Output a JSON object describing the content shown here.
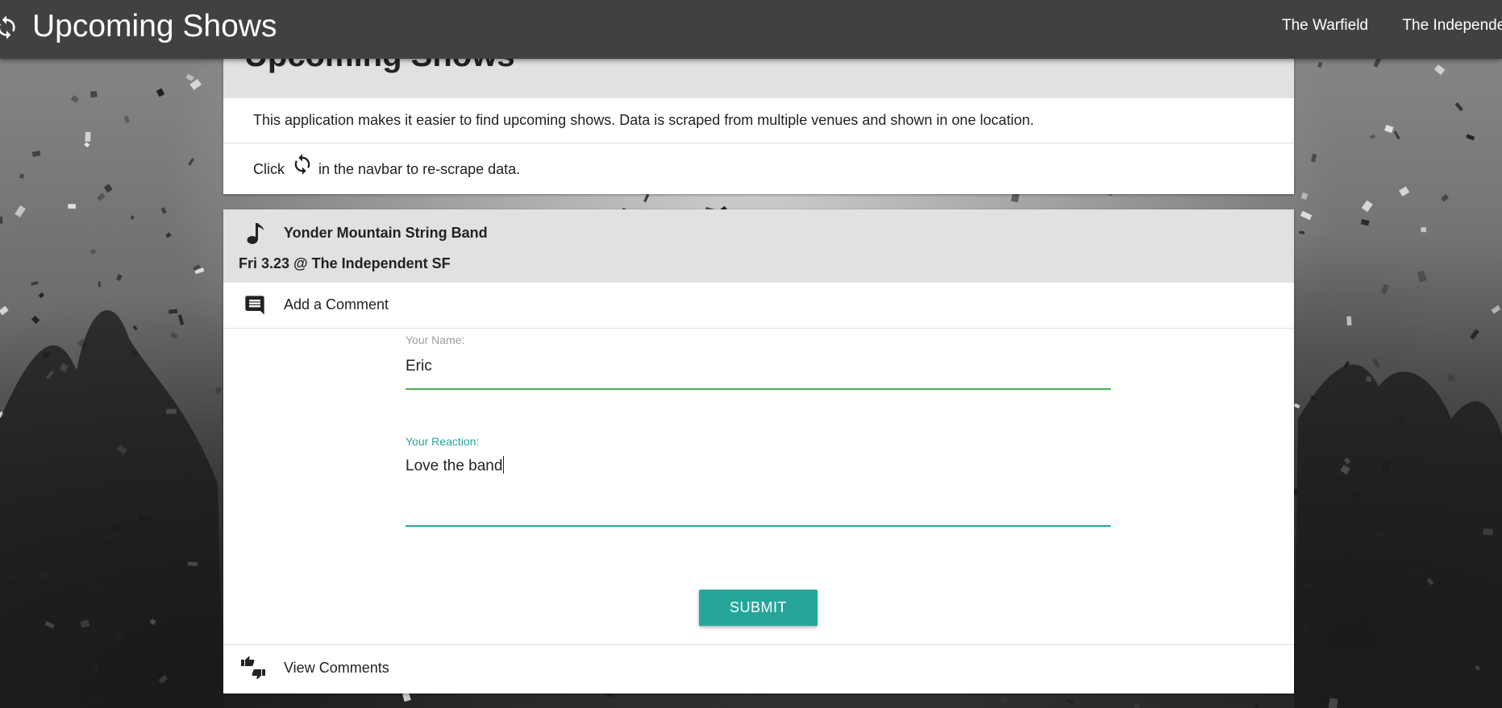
{
  "navbar": {
    "brand": "Upcoming Shows",
    "refresh_icon": "refresh-icon",
    "links": [
      "The Warfield",
      "The Independent"
    ]
  },
  "intro": {
    "title": "Upcoming Shows",
    "description": "This application makes it easier to find upcoming shows. Data is scraped from multiple venues and shown in one location.",
    "click_word": "Click",
    "click_rest": "in the navbar to re-scrape data."
  },
  "show": {
    "band": "Yonder Mountain String Band",
    "date_venue": "Fri 3.23 @ The Independent SF",
    "add_comment_label": "Add a Comment",
    "view_comments_label": "View Comments",
    "form": {
      "name_label": "Your Name:",
      "name_value": "Eric",
      "reaction_label": "Your Reaction:",
      "reaction_value": "Love the band",
      "submit_label": "SUBMIT"
    }
  },
  "colors": {
    "navbar": "#414141",
    "accent": "#26a69a",
    "valid": "#4caf50",
    "card_header": "#e1e1e1"
  }
}
